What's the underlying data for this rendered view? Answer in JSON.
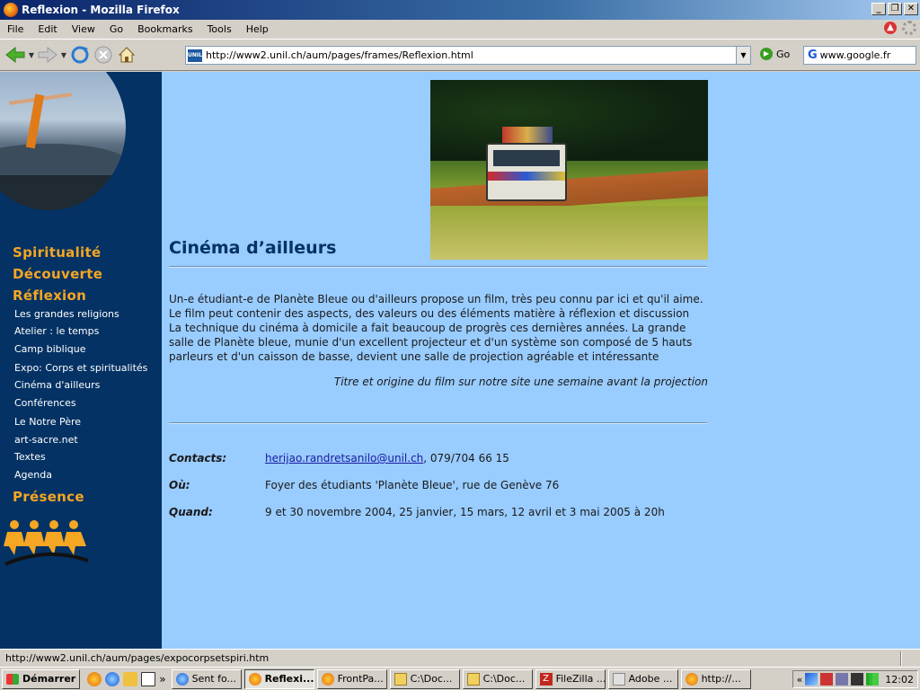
{
  "window": {
    "title": "Reflexion - Mozilla Firefox"
  },
  "menu": [
    "File",
    "Edit",
    "View",
    "Go",
    "Bookmarks",
    "Tools",
    "Help"
  ],
  "toolbar": {
    "url": "http://www2.unil.ch/aum/pages/frames/Reflexion.html",
    "site_icon_label": "UNIL",
    "go_label": "Go",
    "search_value": "www.google.fr"
  },
  "sidebar": {
    "sections": [
      "Spiritualité",
      "Découverte",
      "Réflexion",
      "Présence"
    ],
    "items": [
      "Les grandes religions",
      "Atelier : le temps",
      "Camp biblique",
      "Expo: Corps et spiritualités",
      "Cinéma d'ailleurs",
      "Conférences",
      "Le Notre Père",
      "art-sacre.net",
      "Textes",
      "Agenda"
    ]
  },
  "page": {
    "title": "Cinéma d’ailleurs",
    "paragraph1": "Un-e étudiant-e de Planète Bleue ou d'ailleurs propose un film, très peu connu par ici et qu'il aime. Le film peut contenir des aspects, des valeurs ou des éléments matière à réflexion et discussion",
    "paragraph2": "La technique du cinéma à domicile a fait beaucoup de progrès ces dernières années. La grande salle de Planète bleue, munie d'un excellent projecteur et d'un système son composé de 5 hauts parleurs et d'un caisson de basse, devient une salle de projection agréable et intéressante",
    "note": "Titre et origine du film sur notre site une semaine avant la projection",
    "contacts_label": "Contacts:",
    "contacts_email": "herijao.randretsanilo@unil.ch",
    "contacts_phone": ", 079/704 66 15",
    "ou_label": "Où:",
    "ou_value": "Foyer des étudiants 'Planète Bleue', rue de Genève 76",
    "quand_label": "Quand:",
    "quand_value": "9 et 30 novembre 2004, 25 janvier, 15 mars, 12 avril et 3 mai 2005 à 20h"
  },
  "statusbar": {
    "text": "http://www2.unil.ch/aum/pages/expocorpsetspiri.htm"
  },
  "taskbar": {
    "start": "Démarrer",
    "tasks": [
      "Sent fo...",
      "Reflexi...",
      "FrontPa...",
      "C:\\Doc...",
      "C:\\Doc...",
      "FileZilla ...",
      "Adobe ...",
      "http://..."
    ],
    "chevron": "»",
    "tray_chevron": "«",
    "clock": "12:02"
  }
}
